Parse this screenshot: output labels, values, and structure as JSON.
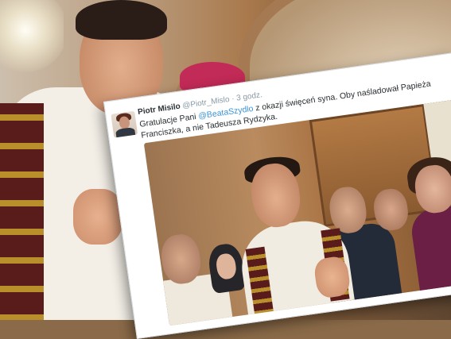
{
  "tweet": {
    "author_name": "Piotr Misilo",
    "handle": "@Piotr_Mislo",
    "separator": "·",
    "time": "3 godz.",
    "text_before_mention": "Gratulacje Pani ",
    "mention": "@BeataSzydlo",
    "text_after_mention": " z okazji święceń syna. Oby naśladował Papieża Franciszka, a nie Tadeusza Rydzyka."
  },
  "colors": {
    "mention": "#3b94d9",
    "meta_text": "#8899a6",
    "body_text": "#292f33",
    "card_background": "#ffffff"
  }
}
